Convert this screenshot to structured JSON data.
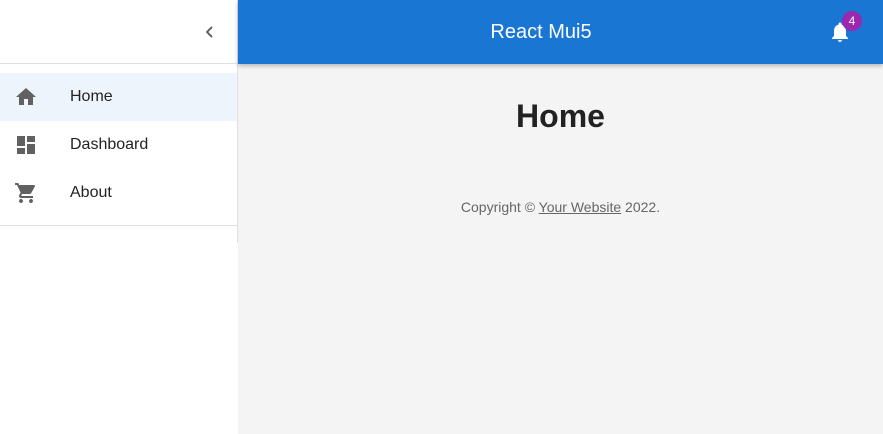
{
  "appbar": {
    "title": "React Mui5",
    "notifications_count": "4"
  },
  "sidebar": {
    "items": [
      {
        "label": "Home",
        "icon": "home-icon",
        "selected": true
      },
      {
        "label": "Dashboard",
        "icon": "dashboard-icon",
        "selected": false
      },
      {
        "label": "About",
        "icon": "shopping-cart-icon",
        "selected": false
      }
    ]
  },
  "main": {
    "title": "Home",
    "footer": {
      "prefix": "Copyright ©",
      "link_text": "Your Website",
      "suffix": "2022."
    }
  },
  "colors": {
    "primary": "#1976d2",
    "badge": "#9c27b0",
    "selected_bg": "#edf4fc",
    "main_bg": "#f4f4f4"
  }
}
